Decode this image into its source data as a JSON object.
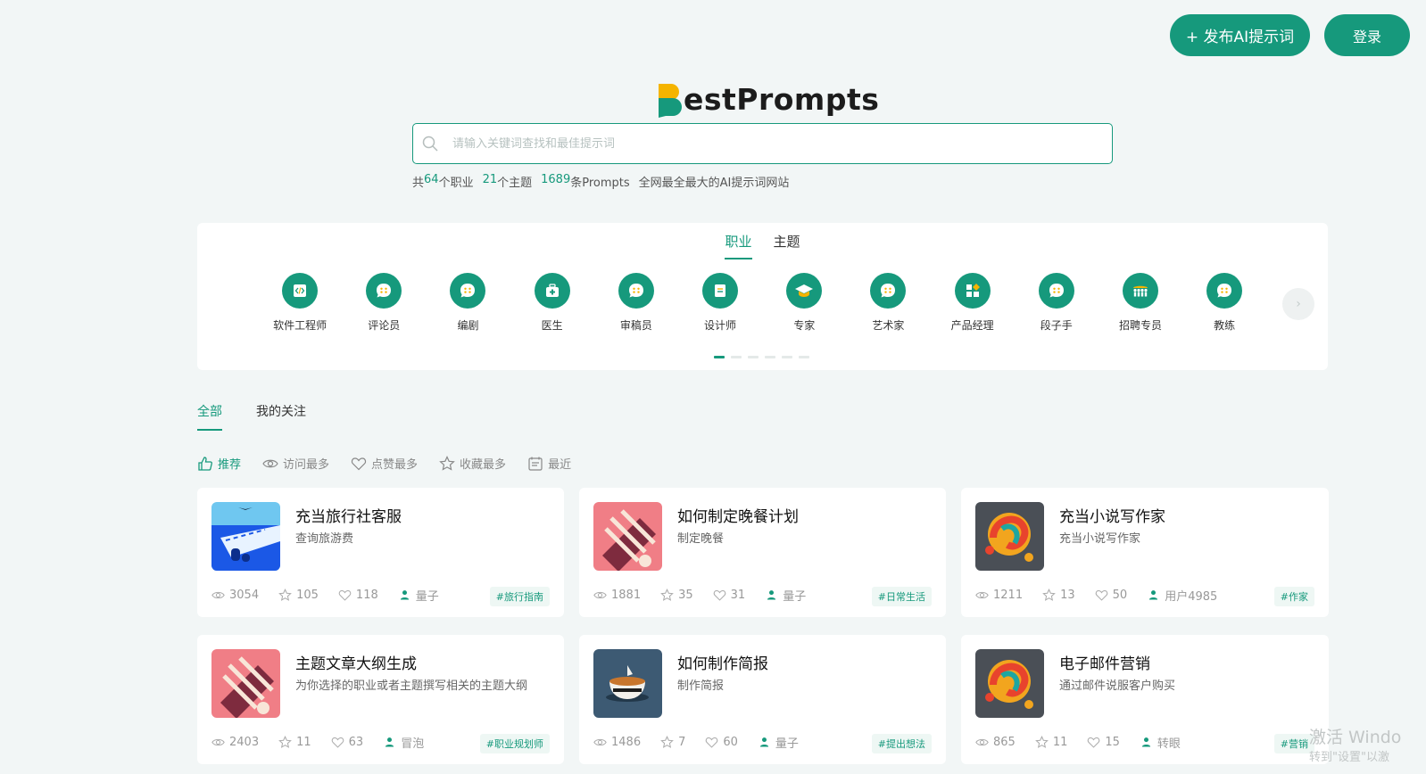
{
  "header": {
    "publish_label": "+ 发布AI提示词",
    "login_label": "登录"
  },
  "logo": {
    "text": "estPrompts",
    "brand_colors": {
      "yellow": "#f5b400",
      "green": "#16997c"
    }
  },
  "search": {
    "placeholder": "请输入关键词查找和最佳提示词"
  },
  "stats": {
    "prefix": "共",
    "jobs_count": "64",
    "jobs_label": "个职业",
    "topics_count": "21",
    "topics_label": "个主题",
    "prompts_count": "1689",
    "prompts_label": "条Prompts",
    "slogan": "全网最全最大的AI提示词网站"
  },
  "category_tabs": [
    {
      "label": "职业",
      "active": true
    },
    {
      "label": "主题",
      "active": false
    }
  ],
  "categories": [
    {
      "label": "软件工程师",
      "icon": "code-icon"
    },
    {
      "label": "评论员",
      "icon": "chat-icon"
    },
    {
      "label": "编剧",
      "icon": "chat-icon"
    },
    {
      "label": "医生",
      "icon": "medkit-icon"
    },
    {
      "label": "审稿员",
      "icon": "chat-icon"
    },
    {
      "label": "设计师",
      "icon": "document-icon"
    },
    {
      "label": "专家",
      "icon": "graduation-cap-icon"
    },
    {
      "label": "艺术家",
      "icon": "chat-icon"
    },
    {
      "label": "产品经理",
      "icon": "grid-icon"
    },
    {
      "label": "段子手",
      "icon": "chat-icon"
    },
    {
      "label": "招聘专员",
      "icon": "people-icon"
    },
    {
      "label": "教练",
      "icon": "chat-icon"
    }
  ],
  "carousel": {
    "next_glyph": "›",
    "page_count": 6,
    "active_page": 1
  },
  "feed_tabs": [
    {
      "label": "全部",
      "active": true
    },
    {
      "label": "我的关注",
      "active": false
    }
  ],
  "sort_options": [
    {
      "label": "推荐",
      "icon": "thumbs-up-icon",
      "active": true
    },
    {
      "label": "访问最多",
      "icon": "eye-icon",
      "active": false
    },
    {
      "label": "点赞最多",
      "icon": "heart-icon",
      "active": false
    },
    {
      "label": "收藏最多",
      "icon": "star-icon",
      "active": false
    },
    {
      "label": "最近",
      "icon": "calendar-icon",
      "active": false
    }
  ],
  "cards": [
    {
      "title": "充当旅行社客服",
      "desc": "查询旅游费",
      "views": "3054",
      "stars": "105",
      "likes": "118",
      "author": "量子",
      "tag": "#旅行指南",
      "thumb": "runway"
    },
    {
      "title": "如何制定晚餐计划",
      "desc": "制定晚餐",
      "views": "1881",
      "stars": "35",
      "likes": "31",
      "author": "量子",
      "tag": "#日常生活",
      "thumb": "pink"
    },
    {
      "title": "充当小说写作家",
      "desc": "充当小说写作家",
      "views": "1211",
      "stars": "13",
      "likes": "50",
      "author": "用户4985",
      "tag": "#作家",
      "thumb": "swirl"
    },
    {
      "title": "主题文章大纲生成",
      "desc": "为你选择的职业或者主题撰写相关的主题大纲",
      "views": "2403",
      "stars": "11",
      "likes": "63",
      "author": "冒泡",
      "tag": "#职业规划师",
      "thumb": "pink"
    },
    {
      "title": "如何制作简报",
      "desc": "制作简报",
      "views": "1486",
      "stars": "7",
      "likes": "60",
      "author": "量子",
      "tag": "#提出想法",
      "thumb": "cup"
    },
    {
      "title": "电子邮件营销",
      "desc": "通过邮件说服客户购买",
      "views": "865",
      "stars": "11",
      "likes": "15",
      "author": "转眼",
      "tag": "#营销",
      "thumb": "swirl"
    }
  ],
  "watermark": {
    "line1": "激活 Windo",
    "line2": "转到\"设置\"以激"
  },
  "colors": {
    "accent": "#16997c",
    "background": "#f2f6f6"
  }
}
